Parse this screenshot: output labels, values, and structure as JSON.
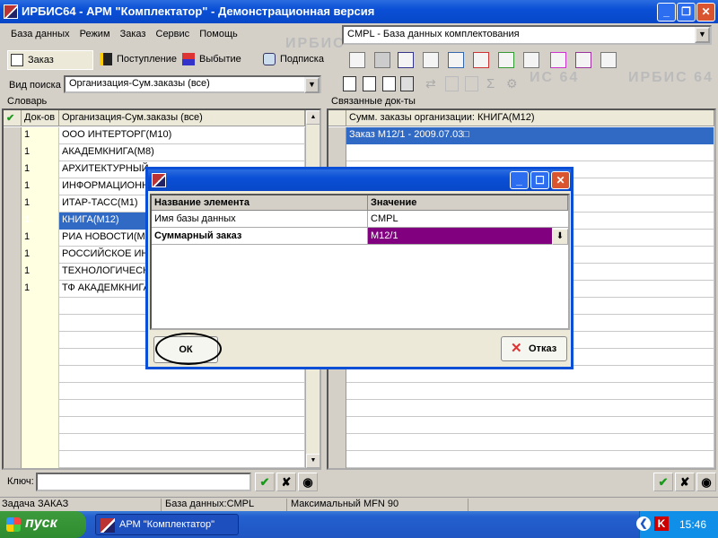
{
  "window": {
    "title": "ИРБИС64 - АРМ \"Комплектатор\" - Демонстрационная версия"
  },
  "menu": [
    "База данных",
    "Режим",
    "Заказ",
    "Сервис",
    "Помощь"
  ],
  "database_select": {
    "value": "CMPL - База данных комплектования"
  },
  "tabs": [
    "Заказ",
    "Поступление",
    "Выбытие",
    "Подписка"
  ],
  "watermark": {
    "top": "ИРБИС",
    "bottom": "ИС 64",
    "right": "ИРБИС 64"
  },
  "search": {
    "label": "Вид поиска",
    "value": "Организация-Сум.заказы (все)"
  },
  "dictionary": {
    "label": "Словарь",
    "col_docs": "Док-ов",
    "col_org": "Организация-Сум.заказы (все)",
    "rows": [
      {
        "count": "1",
        "name": "ООО ИНТЕРТОРГ(М10)"
      },
      {
        "count": "1",
        "name": "АКАДЕМКНИГА(М8)"
      },
      {
        "count": "1",
        "name": "АРХИТЕКТУРНЫЙ"
      },
      {
        "count": "1",
        "name": "ИНФОРМАЦИОННО"
      },
      {
        "count": "1",
        "name": "ИТАР-ТАСС(М1)"
      },
      {
        "count": "1",
        "name": "КНИГА(М12)"
      },
      {
        "count": "1",
        "name": "РИА НОВОСТИ(М6"
      },
      {
        "count": "1",
        "name": "РОССИЙСКОЕ ИНС"
      },
      {
        "count": "1",
        "name": "ТЕХНОЛОГИЧЕСКИ"
      },
      {
        "count": "1",
        "name": "ТФ АКАДЕМКНИГА"
      }
    ]
  },
  "linked_docs": {
    "label": "Связанные док-ты",
    "header": "Сумм. заказы организации: КНИГА(М12)",
    "rows": [
      "Заказ М12/1 - 2009.07.03□"
    ]
  },
  "key": {
    "label": "Ключ:"
  },
  "status": {
    "task": "Задача ЗАКАЗ",
    "db": "База данных:CMPL",
    "mfn": "Максимальный MFN 90"
  },
  "taskbar": {
    "start": "пуск",
    "app": "АРМ \"Комплектатор\"",
    "time": "15:46",
    "tray_k": "K"
  },
  "dialog": {
    "col_name": "Название элемента",
    "col_value": "Значение",
    "rows": [
      {
        "name": "Имя базы данных",
        "value": "CMPL"
      },
      {
        "name": "Суммарный заказ",
        "value": "М12/1"
      }
    ],
    "ok": "ОК",
    "cancel": "Отказ"
  },
  "colors": {
    "selection": "#316ac5",
    "combo_highlight": "#800080",
    "titlebar": "#0a4fd6"
  }
}
